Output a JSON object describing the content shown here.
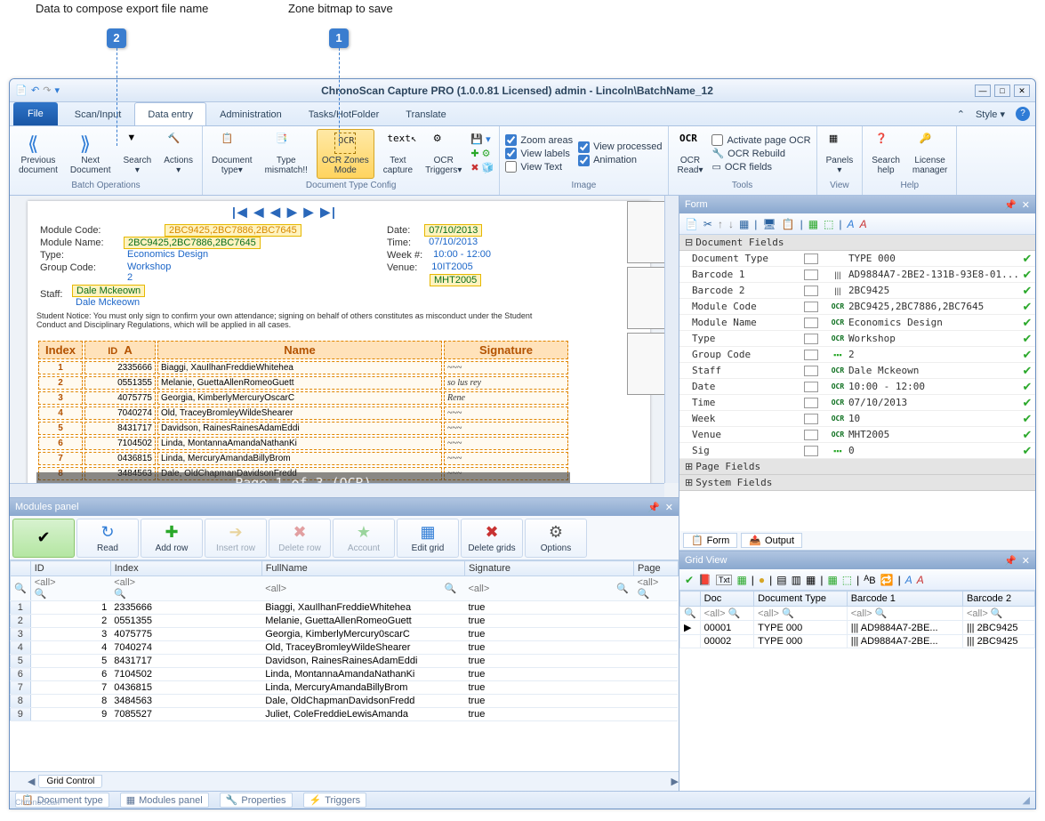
{
  "annotations": {
    "a1": {
      "num": "1",
      "label": "Zone bitmap to save"
    },
    "a2": {
      "num": "2",
      "label": "Data to compose export file name"
    }
  },
  "window": {
    "title": "ChronoScan Capture PRO (1.0.0.81 Licensed) admin  - Lincoln\\BatchName_12"
  },
  "menu": {
    "file": "File",
    "tabs": [
      "Scan/Input",
      "Data entry",
      "Administration",
      "Tasks/HotFolder",
      "Translate"
    ],
    "active_index": 1,
    "style": "Style"
  },
  "ribbon": {
    "groups": [
      {
        "label": "Batch Operations",
        "buttons": [
          {
            "id": "prev-doc",
            "txt": "Previous\ndocument"
          },
          {
            "id": "next-doc",
            "txt": "Next\nDocument"
          },
          {
            "id": "search",
            "txt": "Search\n▾"
          },
          {
            "id": "actions",
            "txt": "Actions\n▾"
          }
        ]
      },
      {
        "label": "Document Type Config",
        "buttons": [
          {
            "id": "doc-type",
            "txt": "Document\ntype▾"
          },
          {
            "id": "type-mismatch",
            "txt": "Type\nmismatch!!"
          },
          {
            "id": "ocr-zones",
            "txt": "OCR Zones\nMode",
            "hl": true
          },
          {
            "id": "text-capture",
            "txt": "Text\ncapture"
          },
          {
            "id": "ocr-triggers",
            "txt": "OCR\nTriggers▾"
          }
        ]
      },
      {
        "label": "Image",
        "checks": [
          [
            "Zoom areas",
            "View processed"
          ],
          [
            "View labels",
            "Animation"
          ],
          [
            "View Text",
            ""
          ]
        ]
      },
      {
        "label": "Tools",
        "buttons": [
          {
            "id": "ocr-read",
            "txt": "OCR\nRead▾"
          }
        ],
        "rows": [
          "Activate page OCR",
          "OCR Rebuild",
          "OCR fields"
        ]
      },
      {
        "label": "View",
        "buttons": [
          {
            "id": "panels",
            "txt": "Panels\n▾"
          }
        ]
      },
      {
        "label": "Help",
        "buttons": [
          {
            "id": "search-help",
            "txt": "Search\nhelp"
          },
          {
            "id": "license-mgr",
            "txt": "License\nmanager"
          }
        ]
      }
    ]
  },
  "document": {
    "nav": "|◀ ◀ ◀ ▶ ▶ ▶|",
    "fields_left": [
      {
        "k": "Module Code:",
        "v": "2BC9425,2BC7886,2BC7645"
      },
      {
        "k": "Module Name:",
        "v": "2BC9425,2BC7886,2BC7645"
      },
      {
        "k": "Type:",
        "v": "Economics Design"
      },
      {
        "k": "Group Code:",
        "v": "Workshop"
      },
      {
        "k": "",
        "v": "2"
      },
      {
        "k": "Staff:",
        "v": "Dale Mckeown"
      },
      {
        "k": "",
        "v": "Dale  Mckeown"
      }
    ],
    "fields_right": [
      {
        "k": "Date:",
        "v": "07/10/2013"
      },
      {
        "k": "Time:",
        "v": "07/10/2013"
      },
      {
        "k": "Week #:",
        "v": "10:00 - 12:00"
      },
      {
        "k": "Venue:",
        "v": "10IT2005"
      },
      {
        "k": "",
        "v": "MHT2005"
      }
    ],
    "notice": "Student Notice: You must only sign to confirm your own attendance; signing on behalf of others constitutes as misconduct under the Student Conduct and Disciplinary Regulations, which will be applied in all cases.",
    "table": {
      "headers": [
        "Index",
        "ID",
        "Name",
        "Signature"
      ],
      "rows": [
        [
          "1",
          "2335666",
          "Biaggi, XauIlhanFreddieWhitehea",
          "~~~"
        ],
        [
          "2",
          "0551355",
          "Melanie, GuettaAllenRomeoGuett",
          "so lus rey"
        ],
        [
          "3",
          "4075775",
          "Georgia, KimberlyMercuryOscarC",
          "Rene"
        ],
        [
          "4",
          "7040274",
          "Old, TraceyBromleyWildeShearer",
          "~~~"
        ],
        [
          "5",
          "8431717",
          "Davidson, RainesRainesAdamEddi",
          "~~~"
        ],
        [
          "6",
          "7104502",
          "Linda, MontannaAmandaNathanKi",
          "~~~"
        ],
        [
          "7",
          "0436815",
          "Linda, MercuryAmandaBillyBrom",
          "~~~"
        ],
        [
          "8",
          "3484563",
          "Dale, OldChapmanDavidsonFredd",
          "~~~"
        ]
      ]
    },
    "page_overlay": "Page 1 of 3 (OCR)"
  },
  "modules_panel": {
    "title": "Modules panel",
    "buttons": [
      {
        "id": "ok",
        "txt": ""
      },
      {
        "id": "read",
        "txt": "Read"
      },
      {
        "id": "add-row",
        "txt": "Add row"
      },
      {
        "id": "insert-row",
        "txt": "Insert row",
        "disabled": true
      },
      {
        "id": "delete-row",
        "txt": "Delete row",
        "disabled": true
      },
      {
        "id": "account",
        "txt": "Account",
        "disabled": true
      },
      {
        "id": "edit-grid",
        "txt": "Edit grid"
      },
      {
        "id": "delete-grids",
        "txt": "Delete grids"
      },
      {
        "id": "options",
        "txt": "Options"
      }
    ],
    "columns": [
      "",
      "ID",
      "Index",
      "FullName",
      "Signature",
      "Page"
    ],
    "filter_placeholder": "<all>",
    "rows": [
      [
        "1",
        "1",
        "2335666",
        "Biaggi, XauIlhanFreddieWhitehea",
        "true",
        ""
      ],
      [
        "2",
        "2",
        "0551355",
        "Melanie, GuettaAllenRomeoGuett",
        "true",
        ""
      ],
      [
        "3",
        "3",
        "4075775",
        "Georgia, KimberlyMercury0scarC",
        "true",
        ""
      ],
      [
        "4",
        "4",
        "7040274",
        "Old, TraceyBromleyWildeShearer",
        "true",
        ""
      ],
      [
        "5",
        "5",
        "8431717",
        "Davidson, RainesRainesAdamEddi",
        "true",
        ""
      ],
      [
        "6",
        "6",
        "7104502",
        "Linda, MontannaAmandaNathanKi",
        "true",
        ""
      ],
      [
        "7",
        "7",
        "0436815",
        "Linda, MercuryAmandaBillyBrom",
        "true",
        ""
      ],
      [
        "8",
        "8",
        "3484563",
        "Dale, OldChapmanDavidsonFredd",
        "true",
        ""
      ],
      [
        "9",
        "9",
        "7085527",
        "Juliet, ColeFreddieLewisAmanda",
        "true",
        ""
      ]
    ],
    "bottom_tab": "Grid Control"
  },
  "form_panel": {
    "title": "Form",
    "group1": "Document Fields",
    "group2": "Page Fields",
    "group3": "System Fields",
    "fields": [
      {
        "k": "Document Type",
        "v": "TYPE 000",
        "ico": ""
      },
      {
        "k": "Barcode 1",
        "v": "AD9884A7-2BE2-131B-93E8-01...",
        "ico": "bar"
      },
      {
        "k": "Barcode 2",
        "v": "2BC9425",
        "ico": "bar"
      },
      {
        "k": "Module Code",
        "v": "2BC9425,2BC7886,2BC7645",
        "ico": "ocr"
      },
      {
        "k": "Module Name",
        "v": "Economics Design",
        "ico": "ocr"
      },
      {
        "k": "Type",
        "v": "Workshop",
        "ico": "ocr"
      },
      {
        "k": "Group Code",
        "v": "2",
        "ico": "grn"
      },
      {
        "k": "Staff",
        "v": "Dale Mckeown",
        "ico": "ocr"
      },
      {
        "k": "Date",
        "v": "10:00 - 12:00",
        "ico": "ocr"
      },
      {
        "k": "Time",
        "v": "07/10/2013",
        "ico": "ocr"
      },
      {
        "k": "Week",
        "v": "10",
        "ico": "ocr"
      },
      {
        "k": "Venue",
        "v": "MHT2005",
        "ico": "ocr"
      },
      {
        "k": "Sig",
        "v": "0",
        "ico": "grn"
      }
    ],
    "tabs": [
      "Form",
      "Output"
    ]
  },
  "grid_view": {
    "title": "Grid View",
    "columns": [
      "",
      "Doc",
      "Document Type",
      "Barcode 1",
      "Barcode 2"
    ],
    "filter_placeholder": "<all>",
    "rows": [
      [
        "▶",
        "00001",
        "TYPE 000",
        "AD9884A7-2BE...",
        "2BC9425"
      ],
      [
        "",
        "00002",
        "TYPE 000",
        "AD9884A7-2BE...",
        "2BC9425"
      ]
    ]
  },
  "statusbar": {
    "items": [
      "Document type",
      "Modules panel",
      "Properties",
      "Triggers"
    ],
    "brand": "ChronoScan"
  }
}
